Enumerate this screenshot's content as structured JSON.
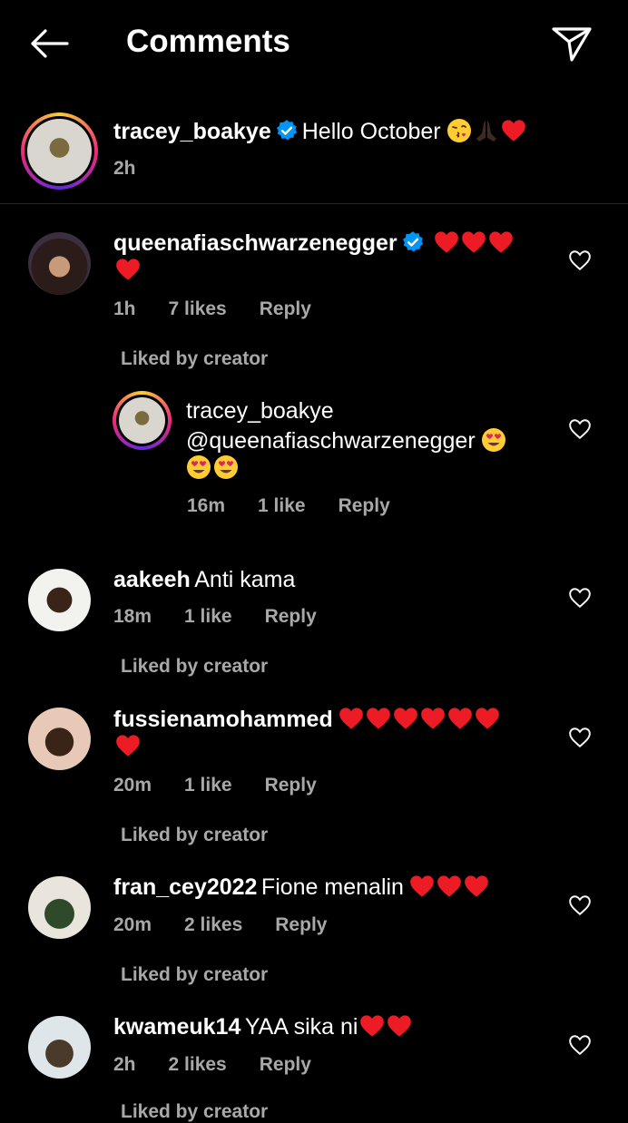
{
  "header": {
    "title": "Comments"
  },
  "post": {
    "username": "tracey_boakye",
    "caption": "Hello October",
    "time": "2h"
  },
  "comments": [
    {
      "username": "queenafiaschwarzenegger",
      "verified": true,
      "time": "1h",
      "likes": "7 likes",
      "reply": "Reply",
      "liked_by": "Liked by creator",
      "reply_item": {
        "username": "tracey_boakye",
        "text": "@queenafiaschwarzenegger",
        "time": "16m",
        "likes": "1 like",
        "reply": "Reply"
      }
    },
    {
      "username": "aakeeh",
      "text": "Anti kama",
      "time": "18m",
      "likes": "1 like",
      "reply": "Reply",
      "liked_by": "Liked by creator"
    },
    {
      "username": "fussienamohammed",
      "time": "20m",
      "likes": "1 like",
      "reply": "Reply",
      "liked_by": "Liked by creator"
    },
    {
      "username": "fran_cey2022",
      "text": "Fione menalin",
      "time": "20m",
      "likes": "2 likes",
      "reply": "Reply",
      "liked_by": "Liked by creator"
    },
    {
      "username": "kwameuk14",
      "text": "YAA sika ni",
      "time": "2h",
      "likes": "2 likes",
      "reply": "Reply",
      "liked_by": "Liked by creator"
    }
  ],
  "colors": {
    "background": "#000000",
    "verified": "#0095f6",
    "heart": "#ed1c24",
    "meta": "#a8a8a8"
  }
}
